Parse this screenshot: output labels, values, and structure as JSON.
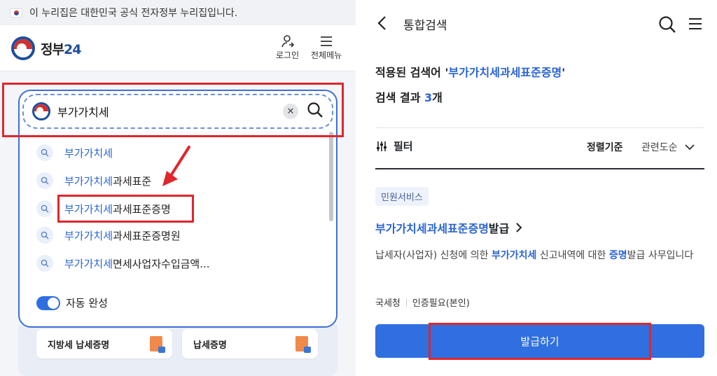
{
  "left": {
    "notice": "이 누리집은 대한민국 공식 전자정부 누리집입니다.",
    "logo_text": "정부",
    "logo_num": "24",
    "login_label": "로그인",
    "menu_label": "전체메뉴",
    "search_value": "부가가치세",
    "suggestions": [
      {
        "hl": "부가가치세",
        "rest": ""
      },
      {
        "hl": "부가가치세",
        "rest": "과세표준"
      },
      {
        "hl": "부가가치세",
        "rest": "과세표준증명"
      },
      {
        "hl": "부가가치세",
        "rest": "과세표준증명원"
      },
      {
        "hl": "부가가치세",
        "rest": "면세사업자수입금액..."
      }
    ],
    "autocomplete_label": "자동 완성",
    "cards": [
      "지방세 납세증명",
      "납세증명"
    ],
    "colors": {
      "accent": "#2f6fe0",
      "highlight_box": "#e0262c"
    }
  },
  "right": {
    "title": "통합검색",
    "query_prefix": "적용된 검색어 '",
    "query_keyword": "부가가치세과세표준증명",
    "query_suffix": "'",
    "count_prefix": "검색 결과 ",
    "count_num": "3",
    "count_suffix": "개",
    "filter_label": "필터",
    "sort_label": "정렬기준",
    "sort_value": "관련도순",
    "badge": "민원서비스",
    "result_title_kw": "부가가치세과세표준증명",
    "result_title_rest": " 발급",
    "desc_a": "납세자(사업자) 신청에 의한 ",
    "desc_kw1": "부가가치세",
    "desc_b": " 신고내역에 대한 ",
    "desc_kw2": "증명",
    "desc_c": "발급 사무입니다",
    "org": "국세청",
    "auth": "인증필요(본인)",
    "button_label": "발급하기"
  }
}
